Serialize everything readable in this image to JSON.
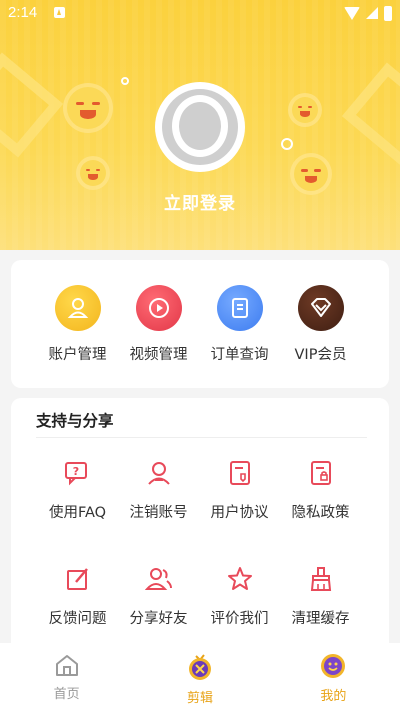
{
  "status_bar": {
    "time": "2:14"
  },
  "profile": {
    "login_label": "立即登录"
  },
  "account_section": {
    "items": [
      {
        "label": "账户管理",
        "icon": "user-icon",
        "color": "#f8c432"
      },
      {
        "label": "视频管理",
        "icon": "play-icon",
        "color": "#ef4d5b"
      },
      {
        "label": "订单查询",
        "icon": "document-icon",
        "color": "#4f8ef5"
      },
      {
        "label": "VIP会员",
        "icon": "diamond-icon",
        "color": "#5a2d1e"
      }
    ]
  },
  "support_section": {
    "title": "支持与分享",
    "items": [
      {
        "label": "使用FAQ",
        "icon": "faq-icon"
      },
      {
        "label": "注销账号",
        "icon": "account-cancel-icon"
      },
      {
        "label": "用户协议",
        "icon": "agreement-icon"
      },
      {
        "label": "隐私政策",
        "icon": "privacy-icon"
      },
      {
        "label": "反馈问题",
        "icon": "feedback-icon"
      },
      {
        "label": "分享好友",
        "icon": "share-friends-icon"
      },
      {
        "label": "评价我们",
        "icon": "star-icon"
      },
      {
        "label": "清理缓存",
        "icon": "broom-icon"
      }
    ]
  },
  "bottom_nav": {
    "items": [
      {
        "label": "首页",
        "icon": "home-icon",
        "active": false
      },
      {
        "label": "剪辑",
        "icon": "scissors-icon",
        "active": true
      },
      {
        "label": "我的",
        "icon": "mine-icon",
        "active": true
      }
    ]
  },
  "colors": {
    "accent": "#fbd13d",
    "icon_red": "#e84a5a",
    "nav_active": "#e8a317",
    "nav_inactive": "#999999"
  }
}
